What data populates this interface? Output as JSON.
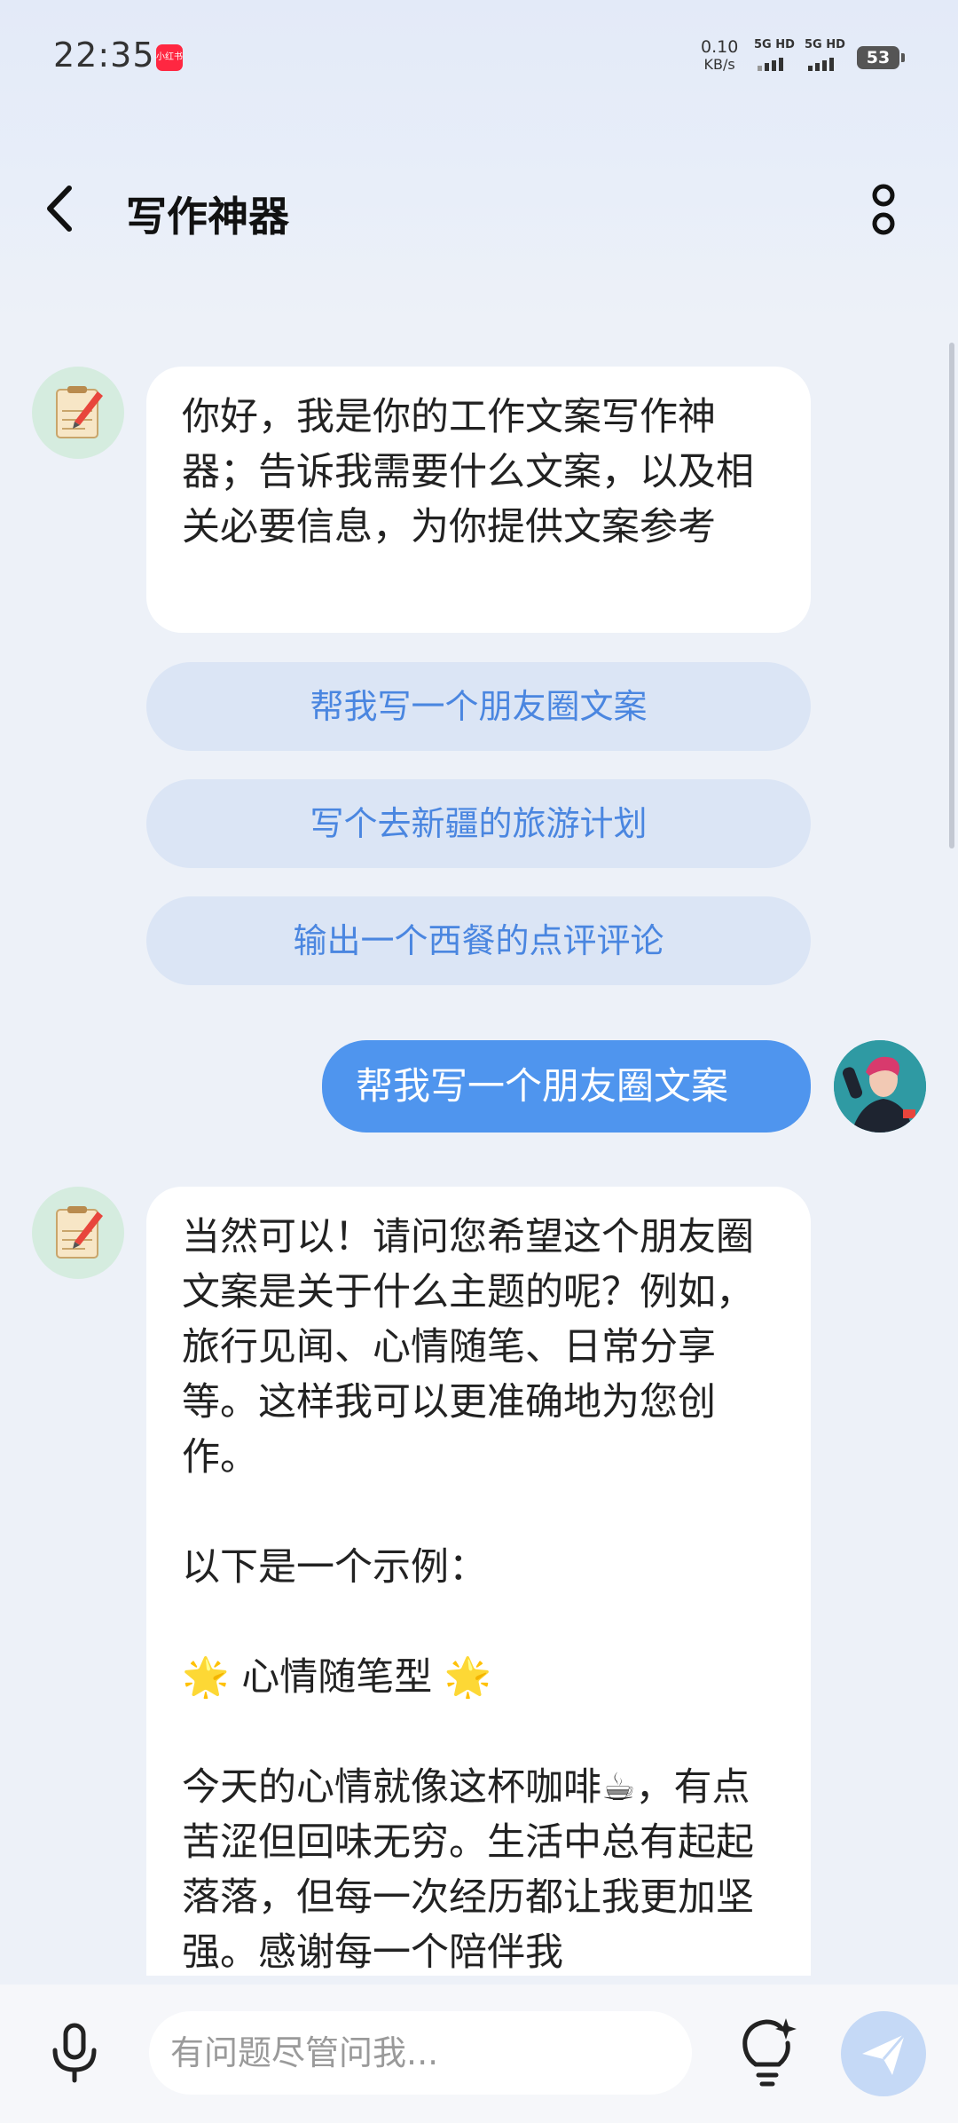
{
  "status_bar": {
    "time": "22:35",
    "app_badge": "小红书",
    "net_speed_value": "0.10",
    "net_speed_unit": "KB/s",
    "sim1_label": "5G HD",
    "sim2_label": "5G HD",
    "battery": "53"
  },
  "header": {
    "title": "写作神器"
  },
  "messages": {
    "bot_greeting": "你好，我是你的工作文案写作神器；告诉我需要什么文案，以及相关必要信息，为你提供文案参考",
    "suggestions": [
      "帮我写一个朋友圈文案",
      "写个去新疆的旅游计划",
      "输出一个西餐的点评评论"
    ],
    "user_message": "帮我写一个朋友圈文案",
    "bot_reply": {
      "p1": "当然可以！请问您希望这个朋友圈文案是关于什么主题的呢？例如，旅行见闻、心情随笔、日常分享等。这样我可以更准确地为您创作。",
      "p2": "以下是一个示例：",
      "p3": "🌟 心情随笔型 🌟",
      "p4": "今天的心情就像这杯咖啡☕，有点苦涩但回味无穷。生活中总有起起落落，但每一次经历都让我更加坚强。感谢每一个陪伴我"
    }
  },
  "input": {
    "placeholder": "有问题尽管问我..."
  },
  "watermark": "b4ec0366d4ae1fcd",
  "colors": {
    "accent": "#4f95ee",
    "suggestion_text": "#4a86e0",
    "suggestion_bg": "#dbe5f5",
    "page_bg": "#edf1f8"
  }
}
